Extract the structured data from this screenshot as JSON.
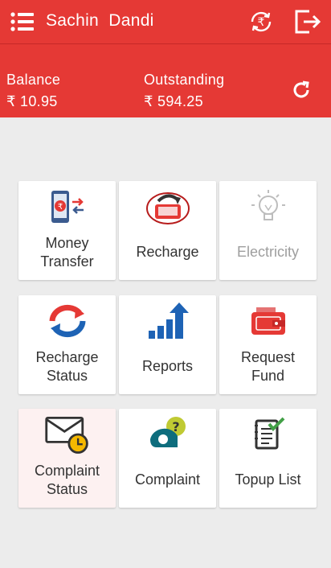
{
  "header": {
    "title": "Sachin  Dandi",
    "menu_icon": "list-menu-icon",
    "rupee_icon": "rupee-refresh-icon",
    "logout_icon": "logout-icon",
    "color": "#e53935"
  },
  "balance": {
    "balance_label": "Balance",
    "balance_value": "₹ 10.95",
    "outstanding_label": "Outstanding",
    "outstanding_value": "₹ 594.25",
    "refresh_icon": "refresh-icon"
  },
  "tiles": [
    {
      "label": "Money\nTransfer",
      "icon": "money-transfer-icon"
    },
    {
      "label": "Recharge",
      "icon": "recharge-icon"
    },
    {
      "label": "Electricity",
      "icon": "lightbulb-icon",
      "disabled": true
    },
    {
      "label": "Recharge\nStatus",
      "icon": "recharge-status-icon"
    },
    {
      "label": "Reports",
      "icon": "reports-bar-chart-icon"
    },
    {
      "label": "Request\nFund",
      "icon": "wallet-icon"
    },
    {
      "label": "Complaint\nStatus",
      "icon": "envelope-clock-icon"
    },
    {
      "label": "Complaint",
      "icon": "help-chat-icon"
    },
    {
      "label": "Topup List",
      "icon": "checklist-icon"
    }
  ]
}
